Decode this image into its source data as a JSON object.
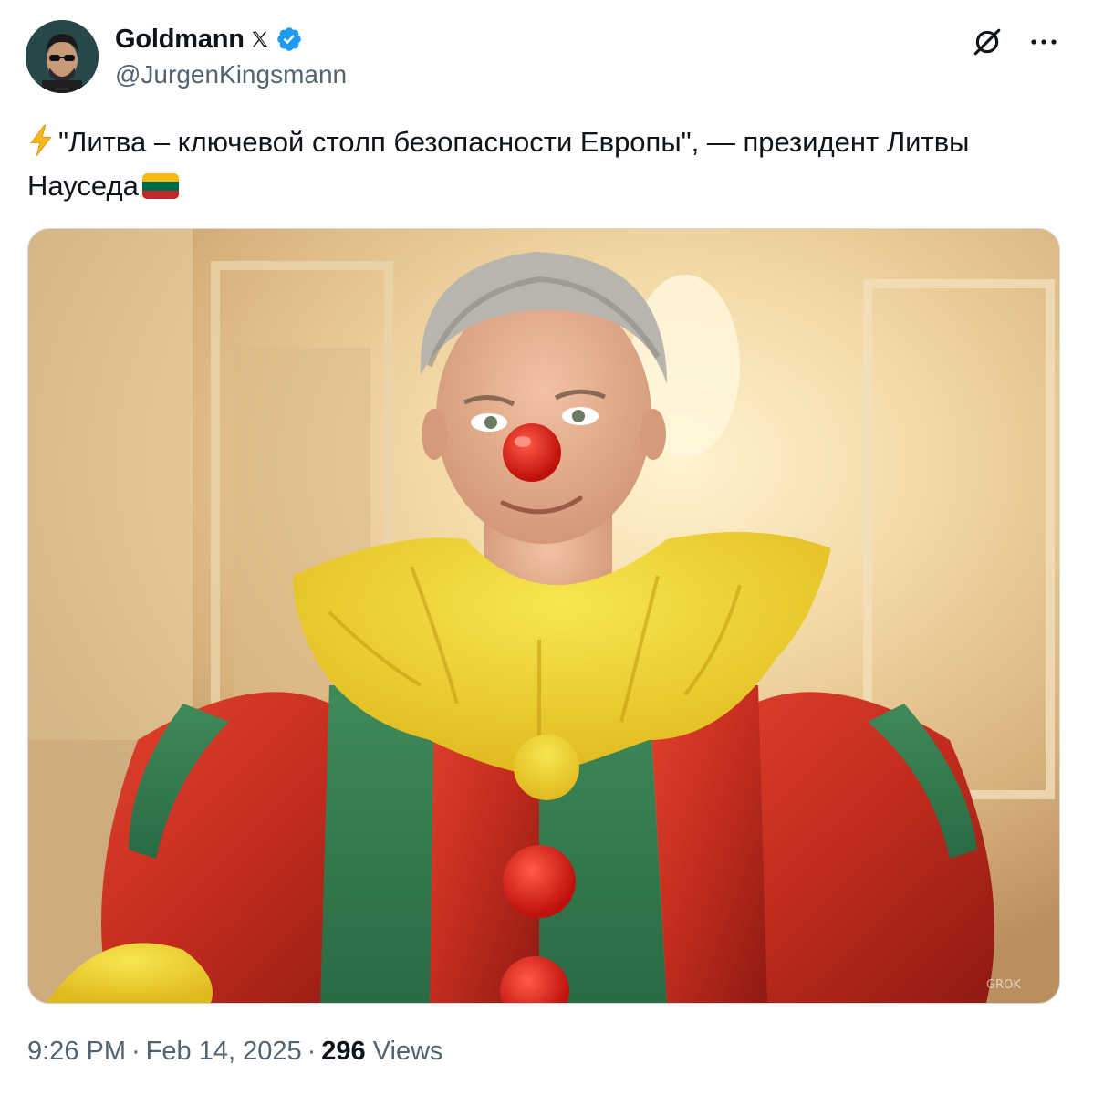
{
  "author": {
    "display_name": "Goldmann",
    "handle": "@JurgenKingsmann",
    "verified": true,
    "platform_icon": "x-logo-icon",
    "avatar_icon": "profile-avatar"
  },
  "actions": {
    "grok_icon": "grok-icon",
    "more_icon": "more-options-icon"
  },
  "tweet": {
    "prefix_icon": "lightning-bolt-icon",
    "text": "\"Литва – ключевой столп безопасности Европы\", — президент Литвы Науседа",
    "flag": "lithuania-flag-icon",
    "flag_colors": [
      "#FDB913",
      "#006A44",
      "#C1272D"
    ]
  },
  "media": {
    "type": "image",
    "subject": "photo",
    "watermark": "GROK"
  },
  "meta": {
    "time": "9:26 PM",
    "date": "Feb 14, 2025",
    "views_count": "296",
    "views_label": "Views",
    "separator": "·"
  },
  "colors": {
    "text_primary": "#0f1419",
    "text_secondary": "#536471",
    "verified_blue": "#1d9bf0",
    "border": "#cfd9de"
  }
}
